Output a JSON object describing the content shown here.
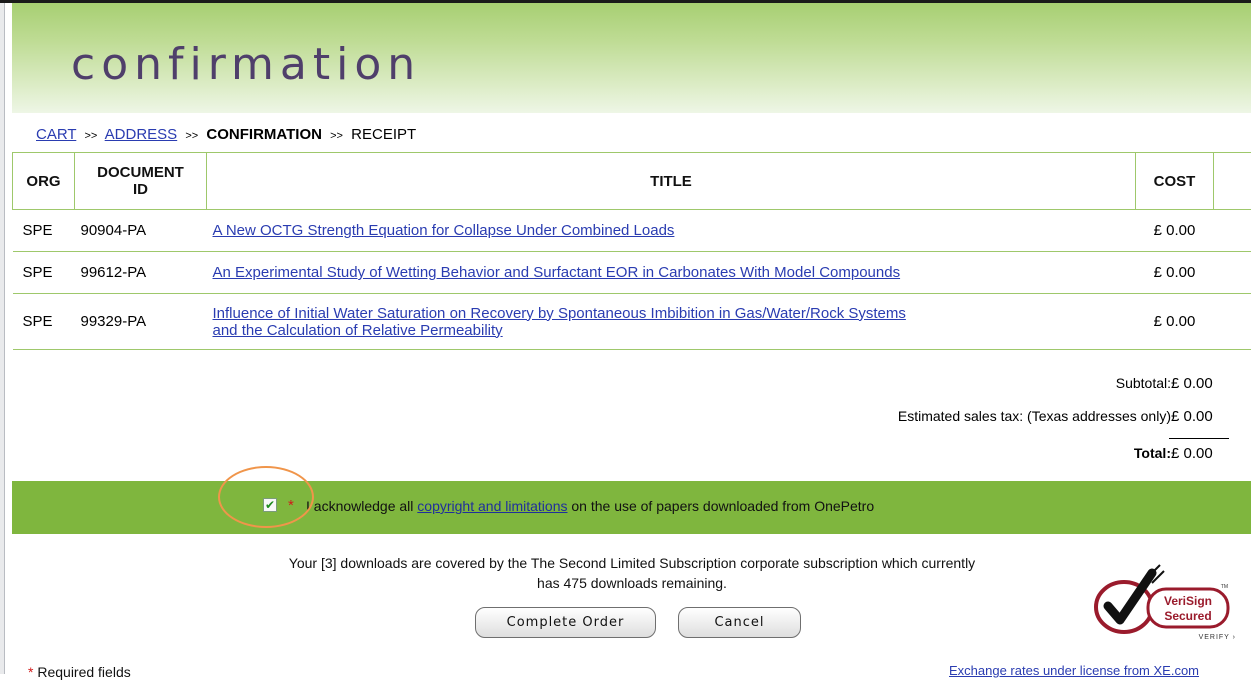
{
  "page": {
    "title": "confirmation"
  },
  "breadcrumb": {
    "cart": "CART",
    "address": "ADDRESS",
    "confirmation": "CONFIRMATION",
    "receipt": "RECEIPT",
    "separator": ">>"
  },
  "table": {
    "headers": {
      "org": "ORG",
      "document_id_line1": "DOCUMENT",
      "document_id_line2": "ID",
      "title": "TITLE",
      "cost": "COST"
    },
    "rows": [
      {
        "org": "SPE",
        "document_id": "90904-PA",
        "title": "A New OCTG Strength Equation for Collapse Under Combined Loads",
        "cost": "£ 0.00"
      },
      {
        "org": "SPE",
        "document_id": "99612-PA",
        "title": "An Experimental Study of Wetting Behavior and Surfactant EOR in Carbonates With Model Compounds",
        "cost": "£ 0.00"
      },
      {
        "org": "SPE",
        "document_id": "99329-PA",
        "title_line1": "Influence of Initial Water Saturation on Recovery by Spontaneous Imbibition in Gas/Water/Rock Systems",
        "title_line2": "and the Calculation of Relative Permeability",
        "cost": "£ 0.00"
      }
    ]
  },
  "totals": {
    "subtotal_label": "Subtotal:",
    "subtotal": "£ 0.00",
    "tax_label": "Estimated sales tax: (Texas addresses only)",
    "tax": "£ 0.00",
    "total_label": "Total:",
    "total": "£ 0.00"
  },
  "acknowledge": {
    "checked": true,
    "required_marker": "*",
    "text_before": "I acknowledge all",
    "link": "copyright and limitations",
    "text_after": "on the use of papers downloaded from OnePetro"
  },
  "notice": {
    "line1": "Your [3] downloads are covered by the The Second Limited Subscription corporate subscription which currently",
    "line2": "has 475 downloads remaining."
  },
  "buttons": {
    "complete": "Complete Order",
    "cancel": "Cancel"
  },
  "verisign": {
    "line1": "VeriSign",
    "line2": "Secured",
    "verify": "VERIFY ›",
    "tm": "TM"
  },
  "footer": {
    "required_marker": "*",
    "required": "Required fields",
    "exchange": "Exchange rates under license from XE.com"
  },
  "colors": {
    "header_green": "#a7cf72",
    "ack_bar": "#7fb63e",
    "link": "#2a3cb1",
    "title_purple": "#4f3f6b",
    "verisign_red": "#9a1b2c"
  },
  "icons": {
    "checkbox": "checkbox-checked",
    "seal": "verisign-checkmark"
  }
}
